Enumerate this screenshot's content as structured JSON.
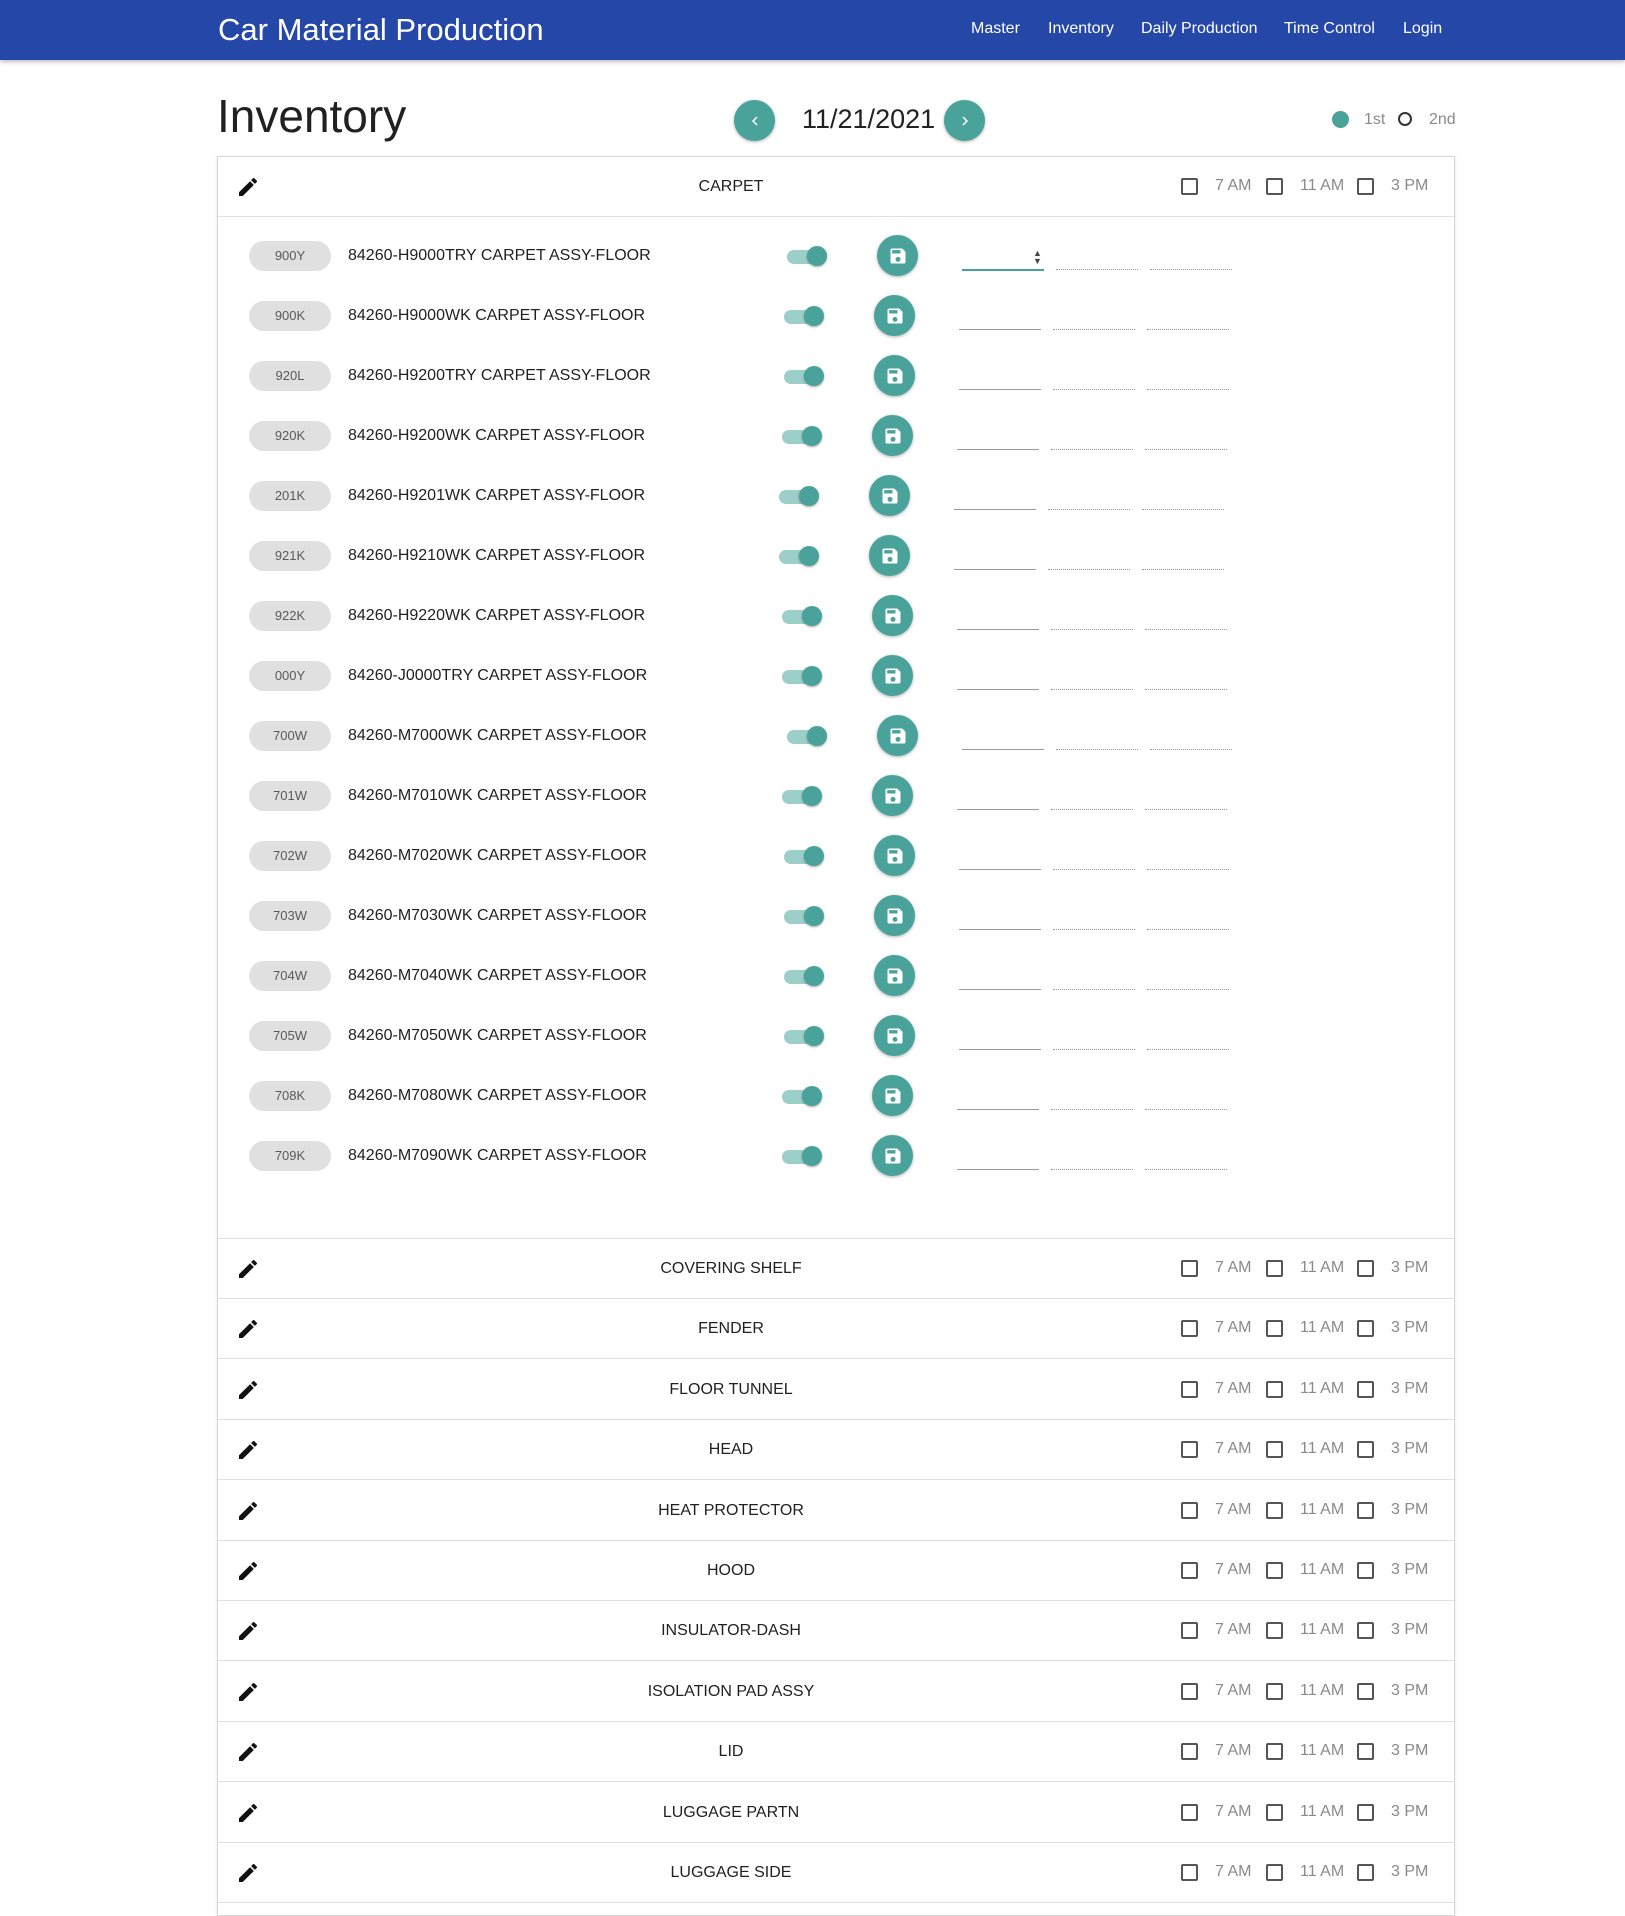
{
  "app": {
    "title": "Car Material Production"
  },
  "nav": [
    {
      "label": "Master"
    },
    {
      "label": "Inventory"
    },
    {
      "label": "Daily Production"
    },
    {
      "label": "Time Control"
    },
    {
      "label": "Login"
    }
  ],
  "page": {
    "title": "Inventory",
    "date": "11/21/2021"
  },
  "shift": {
    "options": [
      "1st",
      "2nd"
    ],
    "selected": "1st"
  },
  "time_slots": [
    "7 AM",
    "11 AM",
    "3 PM"
  ],
  "expanded_group": {
    "name": "CARPET",
    "items": [
      {
        "code": "900Y",
        "name": "84260-H9000TRY CARPET ASSY-FLOOR",
        "enabled": true
      },
      {
        "code": "900K",
        "name": "84260-H9000WK CARPET ASSY-FLOOR",
        "enabled": true
      },
      {
        "code": "920L",
        "name": "84260-H9200TRY CARPET ASSY-FLOOR",
        "enabled": true
      },
      {
        "code": "920K",
        "name": "84260-H9200WK CARPET ASSY-FLOOR",
        "enabled": true
      },
      {
        "code": "201K",
        "name": "84260-H9201WK CARPET ASSY-FLOOR",
        "enabled": true
      },
      {
        "code": "921K",
        "name": "84260-H9210WK CARPET ASSY-FLOOR",
        "enabled": true
      },
      {
        "code": "922K",
        "name": "84260-H9220WK CARPET ASSY-FLOOR",
        "enabled": true
      },
      {
        "code": "000Y",
        "name": "84260-J0000TRY CARPET ASSY-FLOOR",
        "enabled": true
      },
      {
        "code": "700W",
        "name": "84260-M7000WK CARPET ASSY-FLOOR",
        "enabled": true
      },
      {
        "code": "701W",
        "name": "84260-M7010WK CARPET ASSY-FLOOR",
        "enabled": true
      },
      {
        "code": "702W",
        "name": "84260-M7020WK CARPET ASSY-FLOOR",
        "enabled": true
      },
      {
        "code": "703W",
        "name": "84260-M7030WK CARPET ASSY-FLOOR",
        "enabled": true
      },
      {
        "code": "704W",
        "name": "84260-M7040WK CARPET ASSY-FLOOR",
        "enabled": true
      },
      {
        "code": "705W",
        "name": "84260-M7050WK CARPET ASSY-FLOOR",
        "enabled": true
      },
      {
        "code": "708K",
        "name": "84260-M7080WK CARPET ASSY-FLOOR",
        "enabled": true
      },
      {
        "code": "709K",
        "name": "84260-M7090WK CARPET ASSY-FLOOR",
        "enabled": true
      }
    ]
  },
  "collapsed_groups": [
    {
      "name": "COVERING SHELF"
    },
    {
      "name": "FENDER"
    },
    {
      "name": "FLOOR TUNNEL"
    },
    {
      "name": "HEAD"
    },
    {
      "name": "HEAT PROTECTOR"
    },
    {
      "name": "HOOD"
    },
    {
      "name": "INSULATOR-DASH"
    },
    {
      "name": "ISOLATION PAD ASSY"
    },
    {
      "name": "LID"
    },
    {
      "name": "LUGGAGE PARTN"
    },
    {
      "name": "LUGGAGE SIDE"
    }
  ],
  "icons": {
    "edit": "pencil-icon",
    "save": "floppy-disk-icon",
    "prev": "chevron-left-icon",
    "next": "chevron-right-icon"
  },
  "colors": {
    "appbar": "#2447a8",
    "accent": "#4aa39b"
  }
}
